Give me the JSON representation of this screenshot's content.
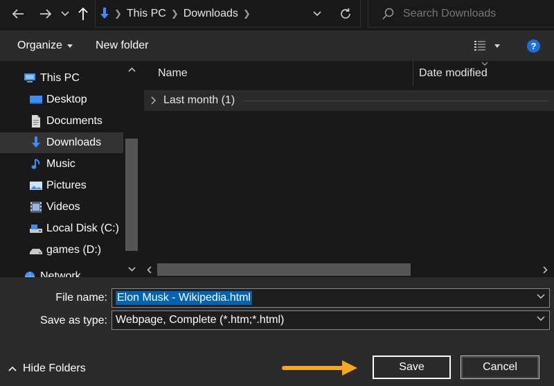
{
  "address_bar": {
    "back_icon": "arrow-left-icon",
    "forward_icon": "arrow-right-icon",
    "recent_icon": "chevron-down-icon",
    "up_icon": "arrow-up-icon",
    "location_icon": "downloads-arrow-icon",
    "breadcrumb": [
      "This PC",
      "Downloads"
    ],
    "refresh_icon": "refresh-icon",
    "search_placeholder": "Search Downloads"
  },
  "toolbar": {
    "organize_label": "Organize",
    "new_folder_label": "New folder",
    "view_icon": "details-view-icon",
    "help_label": "?"
  },
  "nav_pane": {
    "items": [
      {
        "label": "This PC",
        "icon": "computer-icon"
      },
      {
        "label": "Desktop",
        "icon": "desktop-icon"
      },
      {
        "label": "Documents",
        "icon": "documents-icon"
      },
      {
        "label": "Downloads",
        "icon": "downloads-icon",
        "selected": true
      },
      {
        "label": "Music",
        "icon": "music-icon"
      },
      {
        "label": "Pictures",
        "icon": "pictures-icon"
      },
      {
        "label": "Videos",
        "icon": "videos-icon"
      },
      {
        "label": "Local Disk (C:)",
        "icon": "local-disk-icon"
      },
      {
        "label": "games (D:)",
        "icon": "drive-icon"
      },
      {
        "label": "Network",
        "icon": "network-icon"
      }
    ]
  },
  "file_list": {
    "columns": [
      "Name",
      "Date modified"
    ],
    "groups": [
      {
        "label": "Last month (1)"
      }
    ]
  },
  "save_panel": {
    "file_name_label": "File name:",
    "file_name_value": "Elon Musk - Wikipedia.html",
    "save_type_label": "Save as type:",
    "save_type_value": "Webpage, Complete (*.htm;*.html)",
    "hide_folders_label": "Hide Folders",
    "save_label": "Save",
    "cancel_label": "Cancel"
  },
  "colors": {
    "accent_arrow": "#f5a623",
    "selection": "#0063b1",
    "folder_blue": "#3c8df5"
  }
}
